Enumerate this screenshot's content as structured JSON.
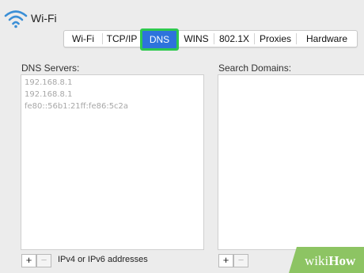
{
  "header": {
    "title": "Wi-Fi",
    "icon": "wifi-icon"
  },
  "tabs": [
    {
      "label": "Wi-Fi",
      "active": false
    },
    {
      "label": "TCP/IP",
      "active": false
    },
    {
      "label": "DNS",
      "active": true
    },
    {
      "label": "WINS",
      "active": false
    },
    {
      "label": "802.1X",
      "active": false
    },
    {
      "label": "Proxies",
      "active": false
    },
    {
      "label": "Hardware",
      "active": false
    }
  ],
  "dns": {
    "label": "DNS Servers:",
    "servers": [
      "192.168.8.1",
      "192.168.8.1",
      "fe80::56b1:21ff:fe86:5c2a"
    ],
    "add_button": "+",
    "remove_button": "−",
    "hint": "IPv4 or IPv6 addresses"
  },
  "search": {
    "label": "Search Domains:",
    "add_button": "+",
    "remove_button": "−"
  },
  "watermark": {
    "text_wiki": "wiki",
    "text_how": "How"
  },
  "colors": {
    "active_tab": "#2d73dc",
    "highlight": "#2ec94f",
    "wifi_blue": "#3b8fd6",
    "watermark_green": "#8dc463"
  }
}
